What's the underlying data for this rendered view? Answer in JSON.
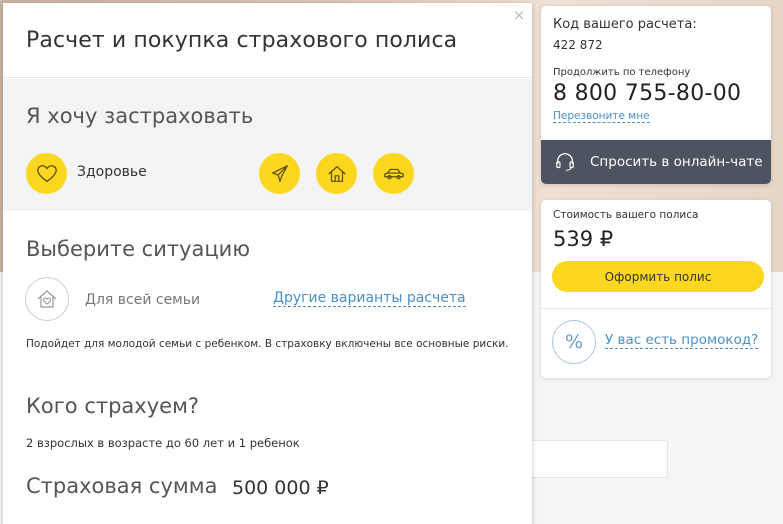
{
  "modal": {
    "title": "Расчет и покупка страхового полиса",
    "close_symbol": "×",
    "insure": {
      "title": "Я хочу застраховать",
      "selected_label": "Здоровье",
      "options": [
        "heart-icon",
        "plane-icon",
        "house-icon",
        "car-icon"
      ]
    },
    "situation": {
      "title": "Выберите ситуацию",
      "family_label": "Для всей семьи",
      "other_link": "Другие варианты расчета",
      "description": "Подойдет для молодой семьи с ребенком. В страховку включены все основные риски."
    },
    "who": {
      "title": "Кого страхуем?",
      "text": "2 взрослых в возрасте до 60 лет и 1 ребенок"
    },
    "sum": {
      "title": "Страховая сумма",
      "value": "500 000 ₽"
    }
  },
  "contact": {
    "code_label": "Код вашего расчета:",
    "code_value": "422 872",
    "phone_label": "Продолжить по телефону",
    "phone_value": "8 800 755-80-00",
    "callback_link": "Перезвоните мне",
    "chat_label": "Спросить в онлайн-чате"
  },
  "price": {
    "label": "Стоимость вашего полиса",
    "value": "539 ₽",
    "buy_button": "Оформить полис",
    "promo_symbol": "%",
    "promo_link": "У вас есть промокод?"
  },
  "colors": {
    "accent_yellow": "#fbd71f",
    "link_blue": "#4a90c9",
    "chat_bar": "#4d5360"
  }
}
